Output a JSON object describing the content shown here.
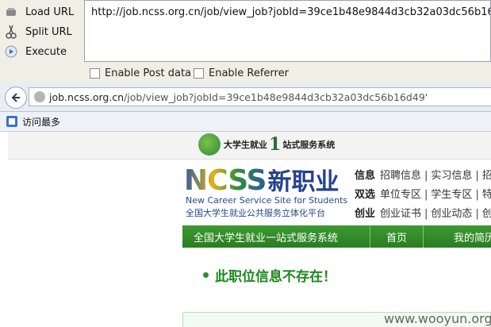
{
  "hackbar": {
    "load_url_label": "Load URL",
    "split_url_label": "Split URL",
    "execute_label": "Execute",
    "url_value": "http://job.ncss.org.cn/job/view_job?jobId=39ce1b48e9844d3cb32a03dc56b16d49'",
    "enable_post_label": "Enable Post data",
    "enable_referrer_label": "Enable Referrer"
  },
  "browser": {
    "address_domain": "job.ncss.org.cn",
    "address_path": "/job/view_job?jobId=39ce1b48e9844d3cb32a03dc56b16d49'",
    "bookmark_label": "访问最多"
  },
  "site": {
    "top_brand_left": "大学生就业",
    "top_brand_num": "1",
    "top_brand_right": "站式服务系统",
    "logo_ncss": "NCSS",
    "logo_xin": "新职业",
    "logo_sub1": "New Career Service Site for Students",
    "logo_sub2": "全国大学生就业公共服务立体化平台",
    "links": [
      {
        "head": "信息",
        "items": [
          "招聘信息",
          "实习信息",
          "招"
        ]
      },
      {
        "head": "双选",
        "items": [
          "单位专区",
          "学生专区",
          "特"
        ]
      },
      {
        "head": "创业",
        "items": [
          "创业证书",
          "创业动态",
          "创"
        ]
      }
    ],
    "nav_title": "全国大学生就业一站式服务系统",
    "nav_home": "首页",
    "nav_mine": "我的简历",
    "notice": "此职位信息不存在！"
  },
  "watermark": "www.wooyun.org"
}
